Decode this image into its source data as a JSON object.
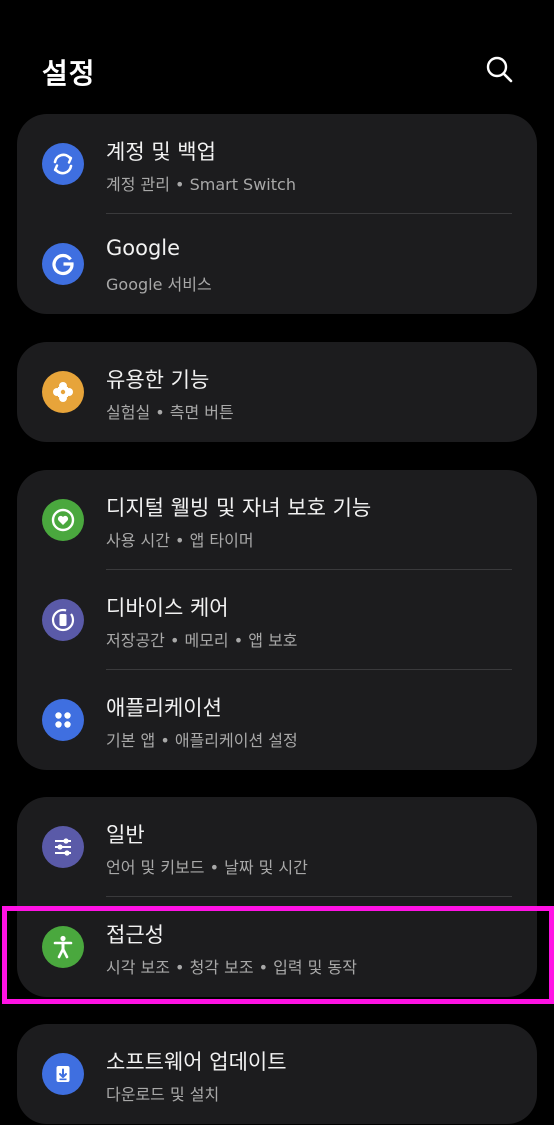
{
  "header": {
    "title": "설정",
    "search_icon": "search-icon"
  },
  "groups": [
    {
      "items": [
        {
          "title": "계정 및 백업",
          "subtitle": "계정 관리 • Smart Switch",
          "icon": "sync-icon",
          "color": "#3f6fe0"
        },
        {
          "title": "Google",
          "subtitle": "Google 서비스",
          "icon": "google-icon",
          "color": "#3f6fe0"
        }
      ]
    },
    {
      "items": [
        {
          "title": "유용한 기능",
          "subtitle": "실험실 • 측면 버튼",
          "icon": "puzzle-icon",
          "color": "#e7a43a"
        }
      ]
    },
    {
      "items": [
        {
          "title": "디지털 웰빙 및 자녀 보호 기능",
          "subtitle": "사용 시간 • 앱 타이머",
          "icon": "wellbeing-icon",
          "color": "#4aa83e"
        },
        {
          "title": "디바이스 케어",
          "subtitle": "저장공간 • 메모리 • 앱 보호",
          "icon": "device-care-icon",
          "color": "#5a5aa8"
        },
        {
          "title": "애플리케이션",
          "subtitle": "기본 앱 • 애플리케이션 설정",
          "icon": "apps-icon",
          "color": "#3f6fe0"
        }
      ]
    },
    {
      "items": [
        {
          "title": "일반",
          "subtitle": "언어 및 키보드 • 날짜 및 시간",
          "icon": "sliders-icon",
          "color": "#5a5aa8"
        },
        {
          "title": "접근성",
          "subtitle": "시각 보조 • 청각 보조 • 입력 및 동작",
          "icon": "accessibility-icon",
          "color": "#4aa83e"
        }
      ]
    },
    {
      "items": [
        {
          "title": "소프트웨어 업데이트",
          "subtitle": "다운로드 및 설치",
          "icon": "software-update-icon",
          "color": "#3f6fe0"
        }
      ]
    }
  ],
  "highlight_color": "#ff12e4"
}
